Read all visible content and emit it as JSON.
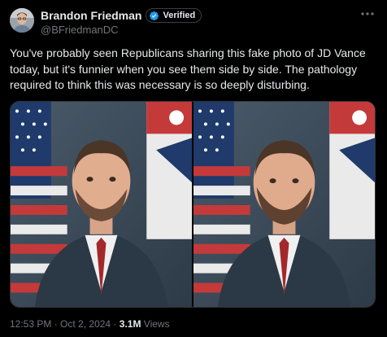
{
  "author": {
    "display_name": "Brandon Friedman",
    "handle": "@BFriedmanDC",
    "verified_label": "Verified"
  },
  "tweet": {
    "text": "You've probably seen Republicans sharing this fake photo of JD Vance today, but it's funnier when you see them side by side. The pathology required to think this was necessary is so deeply disturbing."
  },
  "media": {
    "photos": [
      {
        "name": "left-photo"
      },
      {
        "name": "right-photo"
      }
    ]
  },
  "meta": {
    "time": "12:53 PM",
    "separator": " · ",
    "date": "Oct 2, 2024",
    "views_count": "3.1M",
    "views_label": " Views"
  },
  "colors": {
    "background": "#000000",
    "text_primary": "#e7e9ea",
    "text_secondary": "#71767b",
    "verified_blue": "#1d9bf0"
  },
  "icons": {
    "verified": "verified-badge-icon",
    "more": "more-horizontal-icon"
  }
}
